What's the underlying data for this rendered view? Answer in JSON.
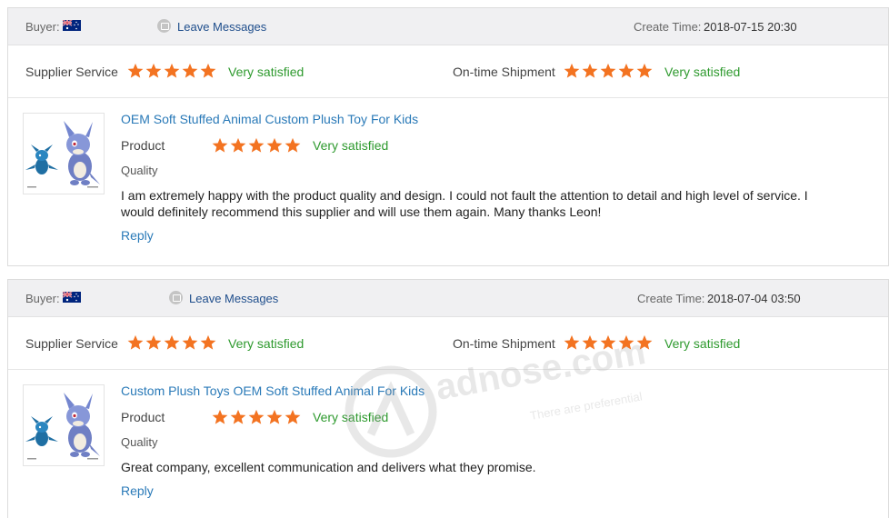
{
  "labels": {
    "buyer": "Buyer:",
    "leave_messages": "Leave Messages",
    "create_time": "Create Time:",
    "supplier_service": "Supplier Service",
    "ontime_shipment": "On-time Shipment",
    "product": "Product",
    "quality": "Quality",
    "reply": "Reply"
  },
  "colors": {
    "star": "#f37321",
    "satisfied_text": "#2e9a2e",
    "link": "#2a7ab8",
    "header_bg": "#f0f0f2"
  },
  "icons": {
    "flag": "australia-flag-icon",
    "message": "message-icon",
    "star": "star-icon"
  },
  "reviews": [
    {
      "create_time": "2018-07-15 20:30",
      "supplier_service": {
        "stars": 5,
        "text": "Very satisfied"
      },
      "ontime_shipment": {
        "stars": 5,
        "text": "Very satisfied"
      },
      "product_title": "OEM Soft Stuffed Animal Custom Plush Toy For Kids",
      "product_rating": {
        "stars": 5,
        "text": "Very satisfied"
      },
      "comment": "I am extremely happy with the product quality and design. I could not fault the attention to detail and high level of service. I would definitely recommend this supplier and will use them again. Many thanks Leon!"
    },
    {
      "create_time": "2018-07-04 03:50",
      "supplier_service": {
        "stars": 5,
        "text": "Very satisfied"
      },
      "ontime_shipment": {
        "stars": 5,
        "text": "Very satisfied"
      },
      "product_title": "Custom Plush Toys OEM Soft Stuffed Animal For Kids",
      "product_rating": {
        "stars": 5,
        "text": "Very satisfied"
      },
      "comment": "Great company, excellent communication and delivers what they promise."
    }
  ],
  "watermark": {
    "brand": "adnose.com",
    "slogan": "There are preferential"
  }
}
